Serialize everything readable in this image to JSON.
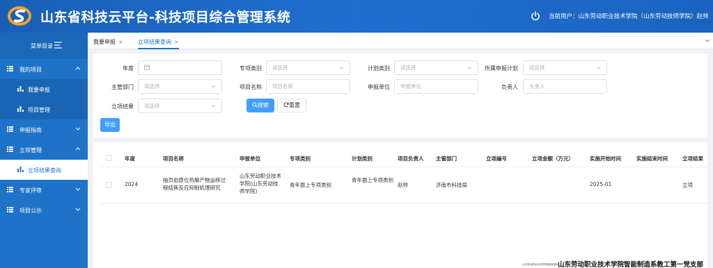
{
  "header": {
    "title": "山东省科技云平台-科技项目综合管理系统",
    "user_info": "当前用户：山东劳动职业技术学院（山东劳动技师学院）赵帅",
    "brand_color": "#1e6fd0"
  },
  "sidebar": {
    "menu_title": "菜单目录",
    "items": [
      {
        "label": "我的项目",
        "icon": "list-icon",
        "expanded": true
      },
      {
        "label": "我要申报",
        "icon": "bar-chart-icon"
      },
      {
        "label": "项目管理",
        "icon": "bar-chart-icon"
      },
      {
        "label": "申报指南",
        "icon": "list-icon"
      },
      {
        "label": "立项管理",
        "icon": "list-icon",
        "expanded": true
      },
      {
        "label": "立项结果查询",
        "icon": "bar-chart-icon",
        "active": true
      },
      {
        "label": "专家评审",
        "icon": "list-icon"
      },
      {
        "label": "项目公示",
        "icon": "list-icon"
      }
    ]
  },
  "tabs": [
    {
      "label": "我要申报",
      "close": "×"
    },
    {
      "label": "立项结果查询",
      "close": "×",
      "active": true
    }
  ],
  "search": {
    "year_label": "年度",
    "category_label": "专项类别",
    "category_placeholder": "请选择",
    "plan_label": "计划类别",
    "plan_placeholder": "请选择",
    "belong_label": "所属申报计划",
    "belong_placeholder": "请选择",
    "dept_label": "主管部门",
    "dept_placeholder": "请选择",
    "name_label": "项目名称",
    "name_placeholder": "项目名称",
    "unit_label": "申报单位",
    "unit_placeholder": "申报单位",
    "leader_label": "负责人",
    "leader_placeholder": "负责人",
    "result_label": "立项结果",
    "result_placeholder": "请选择",
    "search_button": "搜索",
    "reset_button": "重置",
    "export_button": "导出"
  },
  "table": {
    "columns": [
      "年度",
      "项目名称",
      "申报单位",
      "专项类别",
      "计划类别",
      "项目负责人",
      "主管部门",
      "立项编号",
      "立项金额（万元）",
      "实施开始时间",
      "实施结束时间",
      "立项结果"
    ],
    "rows": [
      {
        "year": "2024",
        "name": "抽页岩原位热解产物运移过程结焦反应抑制机理研究",
        "unit": "山东劳动职业技术学院(山东劳动技师学院)",
        "category": "青年面上专项类别",
        "plan": "青年面上专项类别",
        "leader": "赵帅",
        "dept": "济南市科技局",
        "code": "",
        "amount": "",
        "start": "2025-01",
        "end": "",
        "result": "立项"
      }
    ]
  },
  "watermark": {
    "small": "山东劳动职业技术学院智能制造系教工第一党支部",
    "big": "山东劳动职业技术学院智能制造系教工第一党支部"
  }
}
